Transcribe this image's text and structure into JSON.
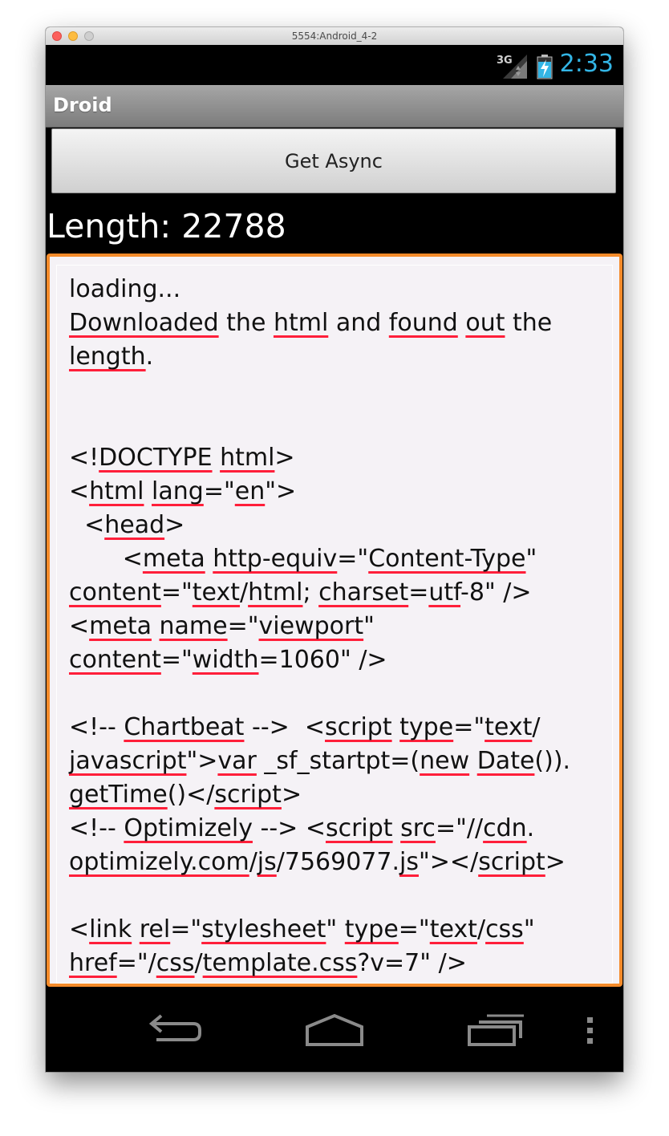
{
  "window": {
    "title": "5554:Android_4-2"
  },
  "status_bar": {
    "network": "3G",
    "time": "2:33",
    "accent_color": "#33b5e5"
  },
  "action_bar": {
    "title": "Droid"
  },
  "button": {
    "label": "Get Async"
  },
  "length_label": "Length: 22788",
  "edit_text": {
    "border_color": "#f58b2a",
    "spell_underline_color": "#ff1f3a",
    "lines": [
      [
        {
          "t": "loading..."
        }
      ],
      [
        {
          "t": "Downloaded",
          "s": 1
        },
        {
          "t": " the "
        },
        {
          "t": "html",
          "s": 1
        },
        {
          "t": " and "
        },
        {
          "t": "found",
          "s": 1
        },
        {
          "t": " "
        },
        {
          "t": "out",
          "s": 1
        },
        {
          "t": " the"
        }
      ],
      [
        {
          "t": "length",
          "s": 1
        },
        {
          "t": "."
        }
      ],
      [],
      [],
      [
        {
          "t": "<!"
        },
        {
          "t": "DOCTYPE",
          "s": 1
        },
        {
          "t": " "
        },
        {
          "t": "html",
          "s": 1
        },
        {
          "t": ">"
        }
      ],
      [
        {
          "t": "<"
        },
        {
          "t": "html",
          "s": 1
        },
        {
          "t": " "
        },
        {
          "t": "lang",
          "s": 1
        },
        {
          "t": "=\""
        },
        {
          "t": "en",
          "s": 1
        },
        {
          "t": "\">"
        }
      ],
      [
        {
          "t": "  <"
        },
        {
          "t": "head",
          "s": 1
        },
        {
          "t": ">"
        }
      ],
      [
        {
          "t": "       <"
        },
        {
          "t": "meta",
          "s": 1
        },
        {
          "t": " "
        },
        {
          "t": "http-equiv",
          "s": 1
        },
        {
          "t": "=\""
        },
        {
          "t": "Content-Type",
          "s": 1
        },
        {
          "t": "\""
        }
      ],
      [
        {
          "t": "content",
          "s": 1
        },
        {
          "t": "=\""
        },
        {
          "t": "text",
          "s": 1
        },
        {
          "t": "/"
        },
        {
          "t": "html",
          "s": 1
        },
        {
          "t": "; "
        },
        {
          "t": "charset",
          "s": 1
        },
        {
          "t": "="
        },
        {
          "t": "utf",
          "s": 1
        },
        {
          "t": "-8\" />"
        }
      ],
      [
        {
          "t": "<"
        },
        {
          "t": "meta",
          "s": 1
        },
        {
          "t": " "
        },
        {
          "t": "name",
          "s": 1
        },
        {
          "t": "=\""
        },
        {
          "t": "viewport",
          "s": 1
        },
        {
          "t": "\""
        }
      ],
      [
        {
          "t": "content",
          "s": 1
        },
        {
          "t": "=\""
        },
        {
          "t": "width",
          "s": 1
        },
        {
          "t": "=1060\" />"
        }
      ],
      [],
      [
        {
          "t": "<!-- "
        },
        {
          "t": "Chartbeat",
          "s": 1
        },
        {
          "t": " -->  <"
        },
        {
          "t": "script",
          "s": 1
        },
        {
          "t": " "
        },
        {
          "t": "type",
          "s": 1
        },
        {
          "t": "=\""
        },
        {
          "t": "text",
          "s": 1
        },
        {
          "t": "/"
        }
      ],
      [
        {
          "t": "javascript",
          "s": 1
        },
        {
          "t": "\">"
        },
        {
          "t": "var",
          "s": 1
        },
        {
          "t": " _sf_startpt=("
        },
        {
          "t": "new",
          "s": 1
        },
        {
          "t": " "
        },
        {
          "t": "Date",
          "s": 1
        },
        {
          "t": "())."
        }
      ],
      [
        {
          "t": "getTime",
          "s": 1
        },
        {
          "t": "()</"
        },
        {
          "t": "script",
          "s": 1
        },
        {
          "t": ">"
        }
      ],
      [
        {
          "t": "<!-- "
        },
        {
          "t": "Optimizely",
          "s": 1
        },
        {
          "t": " --> <"
        },
        {
          "t": "script",
          "s": 1
        },
        {
          "t": " "
        },
        {
          "t": "src",
          "s": 1
        },
        {
          "t": "=\"//"
        },
        {
          "t": "cdn",
          "s": 1
        },
        {
          "t": "."
        }
      ],
      [
        {
          "t": "optimizely.com",
          "s": 1
        },
        {
          "t": "/"
        },
        {
          "t": "js",
          "s": 1
        },
        {
          "t": "/7569077."
        },
        {
          "t": "js",
          "s": 1
        },
        {
          "t": "\"></"
        },
        {
          "t": "script",
          "s": 1
        },
        {
          "t": ">"
        }
      ],
      [],
      [
        {
          "t": "<"
        },
        {
          "t": "link",
          "s": 1
        },
        {
          "t": " "
        },
        {
          "t": "rel",
          "s": 1
        },
        {
          "t": "=\""
        },
        {
          "t": "stylesheet",
          "s": 1
        },
        {
          "t": "\" "
        },
        {
          "t": "type",
          "s": 1
        },
        {
          "t": "=\""
        },
        {
          "t": "text",
          "s": 1
        },
        {
          "t": "/"
        },
        {
          "t": "css",
          "s": 1
        },
        {
          "t": "\""
        }
      ],
      [
        {
          "t": "href",
          "s": 1
        },
        {
          "t": "=\"/"
        },
        {
          "t": "css",
          "s": 1
        },
        {
          "t": "/"
        },
        {
          "t": "template.css",
          "s": 1
        },
        {
          "t": "?v=7\" />"
        }
      ]
    ]
  },
  "nav_bar": {
    "buttons": [
      {
        "name": "back-icon"
      },
      {
        "name": "home-icon"
      },
      {
        "name": "recent-apps-icon"
      },
      {
        "name": "overflow-menu-icon"
      }
    ]
  }
}
